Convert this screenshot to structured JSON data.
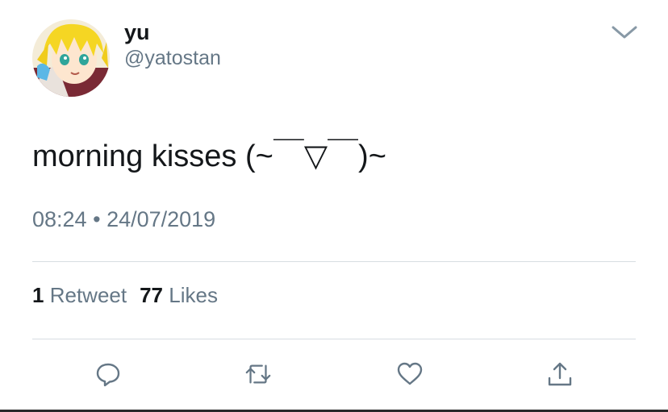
{
  "user": {
    "display_name": "yu",
    "handle": "@yatostan"
  },
  "tweet": {
    "text": "morning kisses (~￣▽￣)~",
    "time": "08:24",
    "separator": "•",
    "date": "24/07/2019"
  },
  "stats": {
    "retweets_count": "1",
    "retweets_label": "Retweet",
    "likes_count": "77",
    "likes_label": "Likes"
  },
  "icons": {
    "menu": "chevron-down-icon",
    "reply": "reply-icon",
    "retweet": "retweet-icon",
    "like": "heart-icon",
    "share": "share-icon"
  },
  "colors": {
    "text": "#14171a",
    "muted": "#657786",
    "divider": "#d7dde2"
  }
}
